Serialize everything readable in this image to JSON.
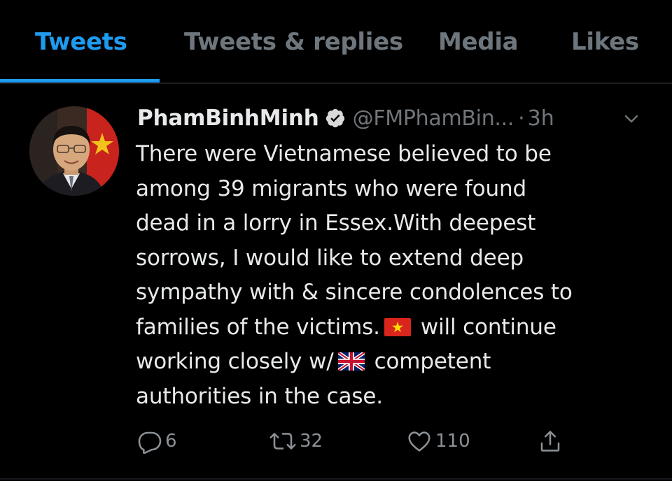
{
  "tabs": [
    {
      "label": "Tweets",
      "active": true
    },
    {
      "label": "Tweets & replies",
      "active": false
    },
    {
      "label": "Media",
      "active": false
    },
    {
      "label": "Likes",
      "active": false
    }
  ],
  "tweet": {
    "display_name": "PhamBinhMinh",
    "handle": "@FMPhamBin...",
    "separator": "·",
    "time": "3h",
    "text_lines": [
      "There were Vietnamese believed to be",
      "among 39 migrants who were found",
      "dead in a lorry in Essex.With deepest",
      "sorrows, I would like to extend deep",
      "sympathy with & sincere condolences to",
      "families of the victims.",
      "will continue",
      "working closely w/",
      "competent",
      "authorities in the case."
    ],
    "emoji": [
      "vietnam-flag",
      "united-kingdom-flag"
    ]
  },
  "actions": {
    "reply_count": "6",
    "retweet_count": "32",
    "like_count": "110"
  },
  "colors": {
    "accent": "#1d9bf0",
    "background": "#000000",
    "muted": "#6e767d",
    "text": "#e7e9ea"
  },
  "icons": [
    "verified-badge-icon",
    "chevron-down-icon",
    "reply-icon",
    "retweet-icon",
    "like-icon",
    "share-icon"
  ]
}
